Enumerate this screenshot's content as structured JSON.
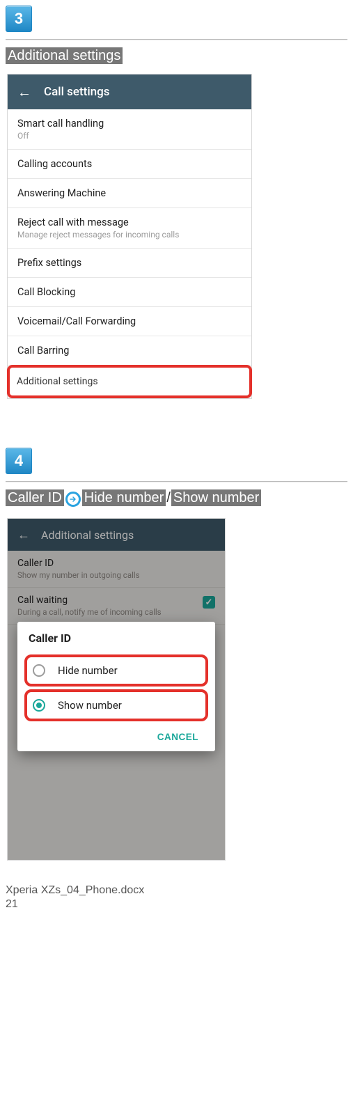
{
  "step3": {
    "number": "3",
    "title": "Additional settings",
    "screenshot": {
      "header": "Call settings",
      "rows": [
        {
          "label": "Smart call handling",
          "sub": "Off"
        },
        {
          "label": "Calling accounts"
        },
        {
          "label": "Answering Machine"
        },
        {
          "label": "Reject call with message",
          "sub": "Manage reject messages for incoming calls"
        },
        {
          "label": "Prefix settings"
        },
        {
          "label": "Call Blocking"
        },
        {
          "label": "Voicemail/Call Forwarding"
        },
        {
          "label": "Call Barring"
        }
      ],
      "highlight": "Additional settings"
    }
  },
  "step4": {
    "number": "4",
    "title_parts": [
      "Caller ID",
      "Hide number",
      "Show number"
    ],
    "slash": "/",
    "screenshot": {
      "header": "Additional settings",
      "bg_rows": {
        "caller_id": {
          "label": "Caller ID",
          "sub": "Show my number in outgoing calls"
        },
        "call_waiting": {
          "label": "Call waiting",
          "sub": "During a call, notify me of incoming calls"
        }
      },
      "dialog": {
        "title": "Caller ID",
        "options": [
          {
            "label": "Hide number",
            "selected": false
          },
          {
            "label": "Show number",
            "selected": true
          }
        ],
        "cancel": "CANCEL"
      }
    }
  },
  "footer": {
    "filename": "Xperia XZs_04_Phone.docx",
    "page": "21"
  }
}
